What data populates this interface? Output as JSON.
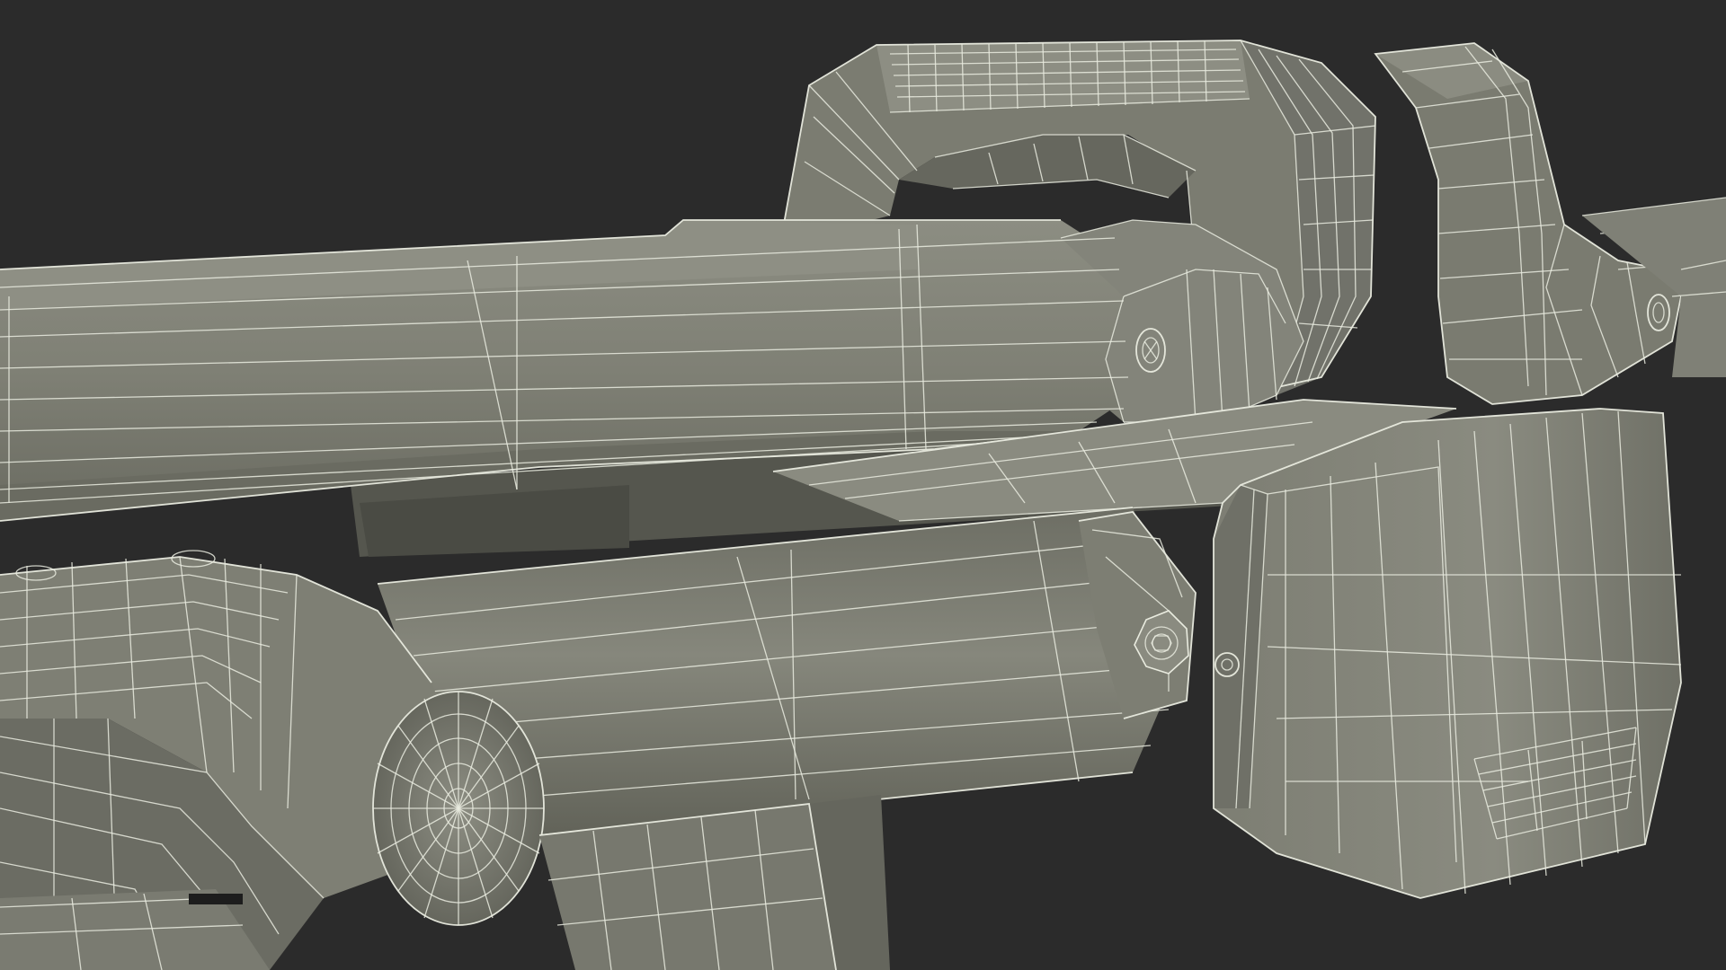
{
  "scene": {
    "description_label": "",
    "colors": {
      "background": "#2b2b2b",
      "surface_light": "#8a8b80",
      "surface_mid": "#7a7b70",
      "surface_dark": "#5f6058",
      "surface_shadow": "#45463f",
      "wire": "#e9ebdf"
    },
    "objects": [
      {
        "name": "upper-rail-tube"
      },
      {
        "name": "carry-handle-left-arch"
      },
      {
        "name": "carry-handle-right-arch"
      },
      {
        "name": "lower-barrel-cylinder"
      },
      {
        "name": "front-hex-block"
      },
      {
        "name": "rear-pivot-joint"
      },
      {
        "name": "grip-stock-lower"
      },
      {
        "name": "hex-bolt-heads"
      }
    ]
  }
}
